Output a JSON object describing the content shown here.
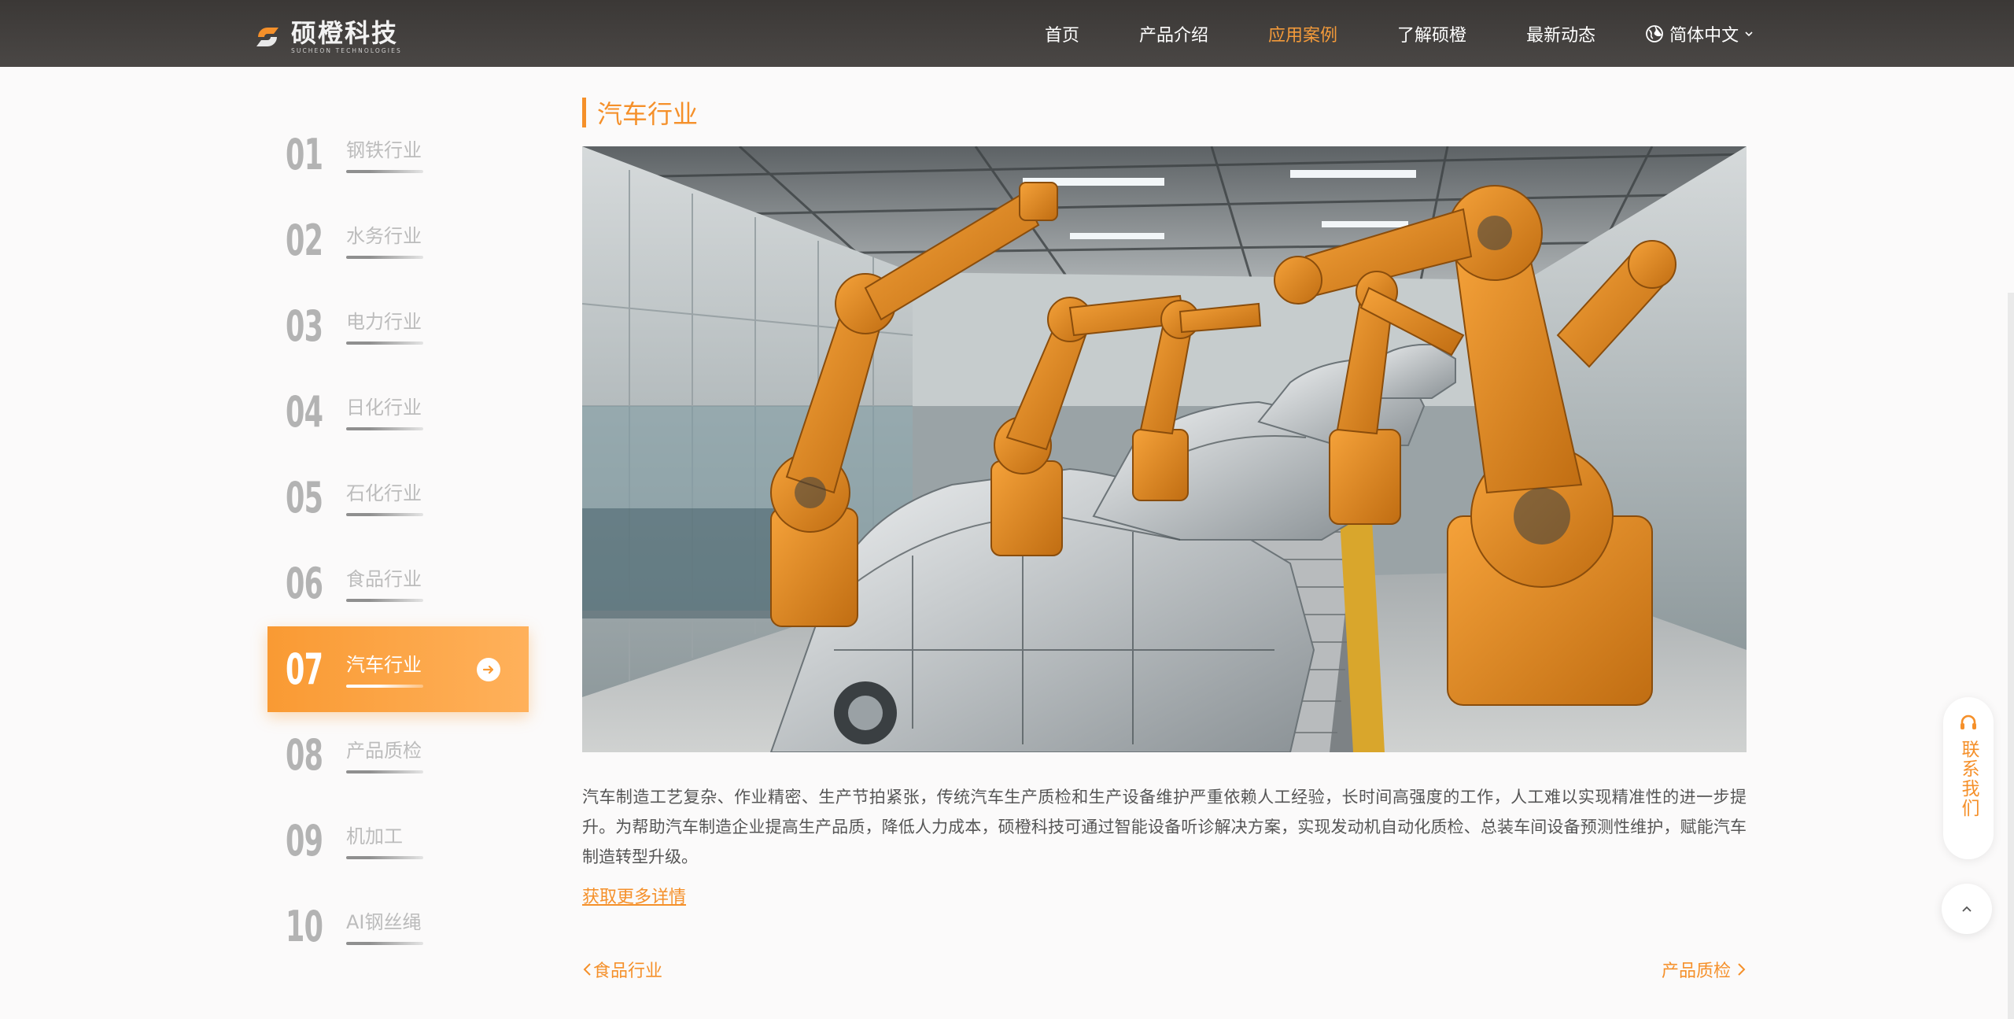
{
  "header": {
    "logo_name": "硕橙科技",
    "logo_sub": "SUCHEON TECHNOLOGIES",
    "nav": [
      {
        "label": "首页",
        "active": false
      },
      {
        "label": "产品介绍",
        "active": false
      },
      {
        "label": "应用案例",
        "active": true
      },
      {
        "label": "了解硕橙",
        "active": false
      },
      {
        "label": "最新动态",
        "active": false
      }
    ],
    "language": "简体中文"
  },
  "sidebar": {
    "items": [
      {
        "num": "01",
        "label": "钢铁行业"
      },
      {
        "num": "02",
        "label": "水务行业"
      },
      {
        "num": "03",
        "label": "电力行业"
      },
      {
        "num": "04",
        "label": "日化行业"
      },
      {
        "num": "05",
        "label": "石化行业"
      },
      {
        "num": "06",
        "label": "食品行业"
      },
      {
        "num": "07",
        "label": "汽车行业",
        "active": true
      },
      {
        "num": "08",
        "label": "产品质检"
      },
      {
        "num": "09",
        "label": "机加工"
      },
      {
        "num": "10",
        "label": "AI钢丝绳"
      }
    ]
  },
  "main": {
    "title": "汽车行业",
    "description": "汽车制造工艺复杂、作业精密、生产节拍紧张，传统汽车生产质检和生产设备维护严重依赖人工经验，长时间高强度的工作，人工难以实现精准性的进一步提升。为帮助汽车制造企业提高生产品质，降低人力成本，硕橙科技可通过智能设备听诊解决方案，实现发动机自动化质检、总装车间设备预测性维护，赋能汽车制造转型升级。",
    "more_link": "获取更多详情",
    "prev": "食品行业",
    "next": "产品质检"
  },
  "floating": {
    "contact": "联系我们"
  },
  "colors": {
    "accent": "#f5902a",
    "header_bg": "#424040",
    "robot_orange": "#e88a1c"
  }
}
